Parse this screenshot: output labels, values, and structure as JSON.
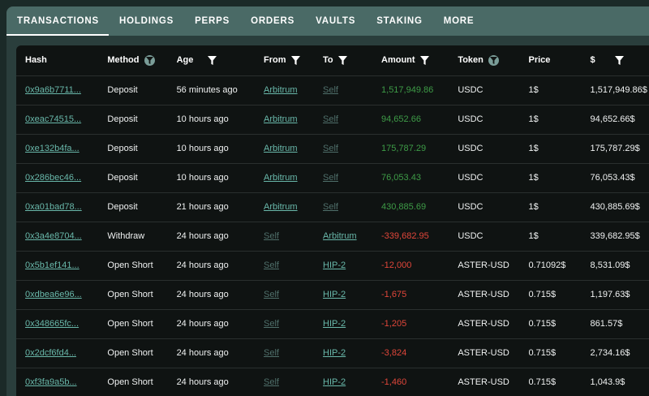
{
  "tabs": [
    {
      "label": "TRANSACTIONS",
      "active": true
    },
    {
      "label": "HOLDINGS",
      "active": false
    },
    {
      "label": "PERPS",
      "active": false
    },
    {
      "label": "ORDERS",
      "active": false
    },
    {
      "label": "VAULTS",
      "active": false
    },
    {
      "label": "STAKING",
      "active": false
    },
    {
      "label": "MORE",
      "active": false
    }
  ],
  "columns": {
    "hash": "Hash",
    "method": "Method",
    "age": "Age",
    "from": "From",
    "to": "To",
    "amount": "Amount",
    "token": "Token",
    "price": "Price",
    "usd": "$"
  },
  "colors": {
    "link": "#69b8aa",
    "self_link": "#4f6f6a",
    "positive": "#3e9c47",
    "negative": "#e0463a",
    "tabbar": "#4a6a66",
    "panel": "#0f1312"
  },
  "rows": [
    {
      "hash": "0x9a6b7711...",
      "method": "Deposit",
      "age": "56 minutes ago",
      "from": "Arbitrum",
      "to": "Self",
      "amount": "1,517,949.86",
      "token": "USDC",
      "price": "1$",
      "usd": "1,517,949.86$"
    },
    {
      "hash": "0xeac74515...",
      "method": "Deposit",
      "age": "10 hours ago",
      "from": "Arbitrum",
      "to": "Self",
      "amount": "94,652.66",
      "token": "USDC",
      "price": "1$",
      "usd": "94,652.66$"
    },
    {
      "hash": "0xe132b4fa...",
      "method": "Deposit",
      "age": "10 hours ago",
      "from": "Arbitrum",
      "to": "Self",
      "amount": "175,787.29",
      "token": "USDC",
      "price": "1$",
      "usd": "175,787.29$"
    },
    {
      "hash": "0x286bec46...",
      "method": "Deposit",
      "age": "10 hours ago",
      "from": "Arbitrum",
      "to": "Self",
      "amount": "76,053.43",
      "token": "USDC",
      "price": "1$",
      "usd": "76,053.43$"
    },
    {
      "hash": "0xa01bad78...",
      "method": "Deposit",
      "age": "21 hours ago",
      "from": "Arbitrum",
      "to": "Self",
      "amount": "430,885.69",
      "token": "USDC",
      "price": "1$",
      "usd": "430,885.69$"
    },
    {
      "hash": "0x3a4e8704...",
      "method": "Withdraw",
      "age": "24 hours ago",
      "from": "Self",
      "to": "Arbitrum",
      "amount": "-339,682.95",
      "token": "USDC",
      "price": "1$",
      "usd": "339,682.95$"
    },
    {
      "hash": "0x5b1ef141...",
      "method": "Open Short",
      "age": "24 hours ago",
      "from": "Self",
      "to": "HIP-2",
      "amount": "-12,000",
      "token": "ASTER-USD",
      "price": "0.71092$",
      "usd": "8,531.09$"
    },
    {
      "hash": "0xdbea6e96...",
      "method": "Open Short",
      "age": "24 hours ago",
      "from": "Self",
      "to": "HIP-2",
      "amount": "-1,675",
      "token": "ASTER-USD",
      "price": "0.715$",
      "usd": "1,197.63$"
    },
    {
      "hash": "0x348665fc...",
      "method": "Open Short",
      "age": "24 hours ago",
      "from": "Self",
      "to": "HIP-2",
      "amount": "-1,205",
      "token": "ASTER-USD",
      "price": "0.715$",
      "usd": "861.57$"
    },
    {
      "hash": "0x2dcf6fd4...",
      "method": "Open Short",
      "age": "24 hours ago",
      "from": "Self",
      "to": "HIP-2",
      "amount": "-3,824",
      "token": "ASTER-USD",
      "price": "0.715$",
      "usd": "2,734.16$"
    },
    {
      "hash": "0xf3fa9a5b...",
      "method": "Open Short",
      "age": "24 hours ago",
      "from": "Self",
      "to": "HIP-2",
      "amount": "-1,460",
      "token": "ASTER-USD",
      "price": "0.715$",
      "usd": "1,043.9$"
    }
  ]
}
